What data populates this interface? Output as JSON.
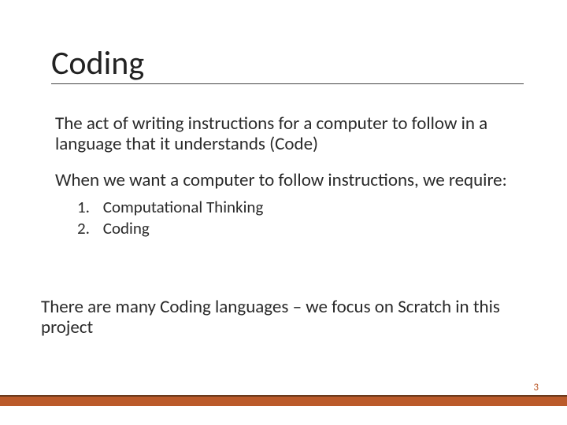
{
  "title": "Coding",
  "para1": "The act of writing instructions for a computer to follow in a language that it understands (Code)",
  "para2": "When we want a computer to follow instructions, we require:",
  "list": {
    "n1": "1.",
    "item1": "Computational Thinking",
    "n2": "2.",
    "item2": "Coding"
  },
  "closing": "There are many Coding languages – we focus on Scratch in this project",
  "page_number": "3"
}
